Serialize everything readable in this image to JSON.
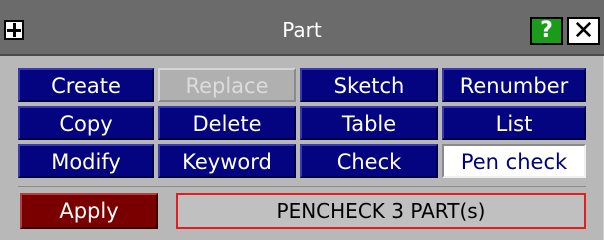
{
  "window": {
    "title": "Part",
    "help_label": "?",
    "close_label": "✕"
  },
  "buttons": {
    "create": "Create",
    "replace": "Replace",
    "sketch": "Sketch",
    "renumber": "Renumber",
    "copy": "Copy",
    "delete": "Delete",
    "table": "Table",
    "list": "List",
    "modify": "Modify",
    "keyword": "Keyword",
    "check": "Check",
    "pen_check": "Pen check"
  },
  "footer": {
    "apply_label": "Apply",
    "status_text": "PENCHECK 3 PART(s)"
  },
  "colors": {
    "button_bg": "#040480",
    "disabled_bg": "#b0b0b0",
    "selected_bg": "#ffffff",
    "apply_bg": "#7a0000",
    "status_border": "#e02020",
    "help_bg": "#1a9b1a",
    "titlebar_bg": "#6b6b6b"
  }
}
